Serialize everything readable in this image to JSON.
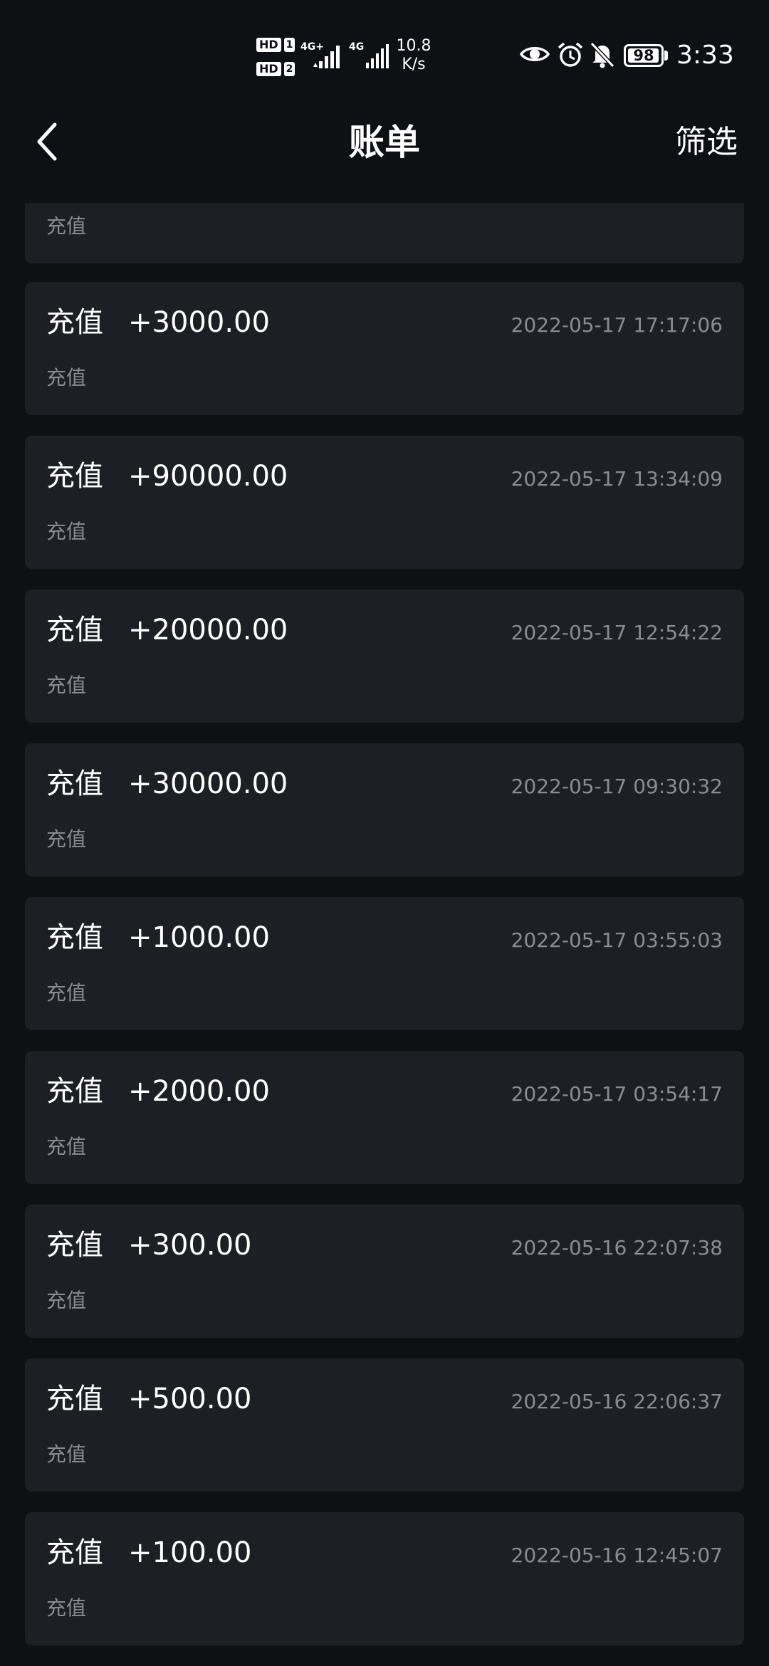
{
  "status_bar": {
    "hd1": "HD",
    "hd1_sim": "1",
    "hd2": "HD",
    "hd2_sim": "2",
    "net1": "4G+",
    "net2": "4G",
    "speed_value": "10.8",
    "speed_unit": "K/s",
    "battery": "98",
    "battery_level": 0.98,
    "time": "3:33"
  },
  "nav": {
    "title": "账单",
    "filter_label": "筛选"
  },
  "partial_item": {
    "desc": "充值"
  },
  "items": [
    {
      "type": "充值",
      "amount": "+3000.00",
      "time": "2022-05-17 17:17:06",
      "desc": "充值"
    },
    {
      "type": "充值",
      "amount": "+90000.00",
      "time": "2022-05-17 13:34:09",
      "desc": "充值"
    },
    {
      "type": "充值",
      "amount": "+20000.00",
      "time": "2022-05-17 12:54:22",
      "desc": "充值"
    },
    {
      "type": "充值",
      "amount": "+30000.00",
      "time": "2022-05-17 09:30:32",
      "desc": "充值"
    },
    {
      "type": "充值",
      "amount": "+1000.00",
      "time": "2022-05-17 03:55:03",
      "desc": "充值"
    },
    {
      "type": "充值",
      "amount": "+2000.00",
      "time": "2022-05-17 03:54:17",
      "desc": "充值"
    },
    {
      "type": "充值",
      "amount": "+300.00",
      "time": "2022-05-16 22:07:38",
      "desc": "充值"
    },
    {
      "type": "充值",
      "amount": "+500.00",
      "time": "2022-05-16 22:06:37",
      "desc": "充值"
    },
    {
      "type": "充值",
      "amount": "+100.00",
      "time": "2022-05-16 12:45:07",
      "desc": "充值"
    }
  ],
  "icons": {
    "back": "chevron-left-icon",
    "eye": "eye-icon",
    "alarm": "alarm-icon",
    "bell": "bell-off-icon"
  },
  "colors": {
    "background": "#0f1014",
    "card": "#1e1f24",
    "secondary_text": "#8a8c93"
  }
}
